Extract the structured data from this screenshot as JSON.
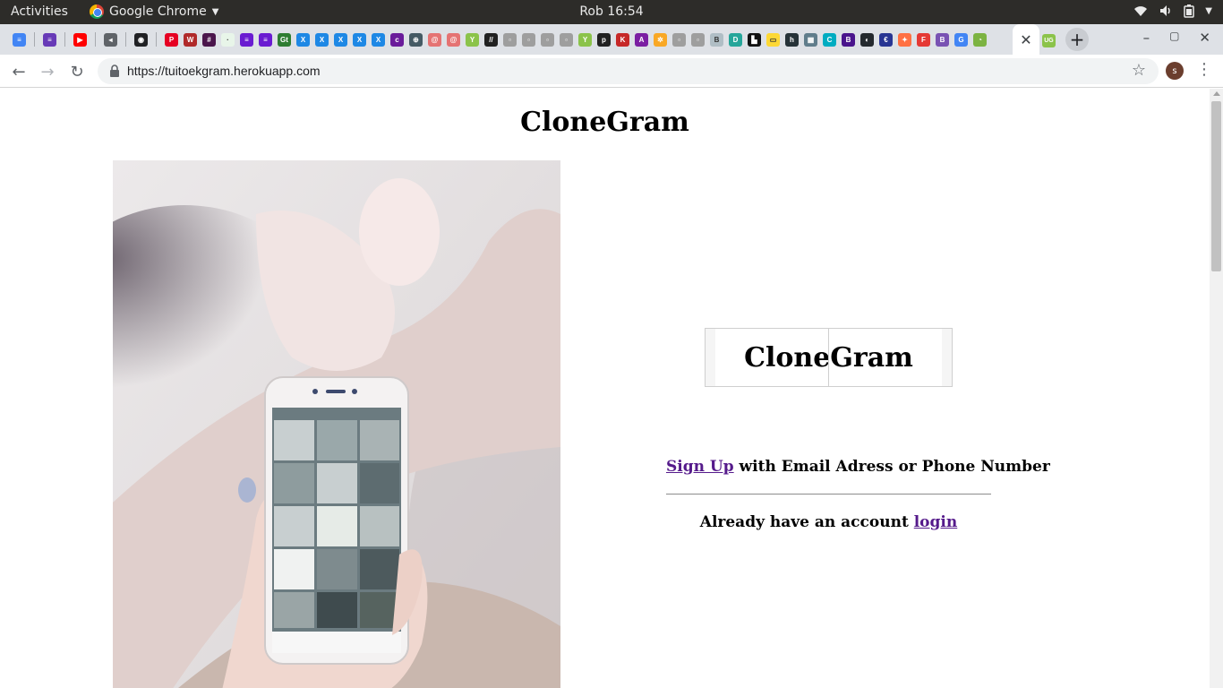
{
  "os_bar": {
    "activities": "Activities",
    "app_name": "Google Chrome",
    "clock": "Rob 16:54",
    "tray_icons": [
      "wifi-icon",
      "volume-icon",
      "battery-icon",
      "power-caret-icon"
    ]
  },
  "tabs": {
    "pinned_favicons": [
      {
        "name": "google-docs-favicon",
        "color": "#4285f4",
        "glyph": "≡"
      },
      {
        "name": "google-forms-favicon",
        "color": "#673ab7",
        "glyph": "≡"
      },
      {
        "name": "youtube-favicon",
        "color": "#ff0000",
        "glyph": "▶"
      },
      {
        "name": "audio-favicon",
        "color": "#5f6368",
        "glyph": "◂"
      },
      {
        "name": "record-favicon",
        "color": "#202124",
        "glyph": "◉"
      }
    ],
    "favicons": [
      {
        "name": "pinterest-favicon",
        "color": "#e60023",
        "glyph": "P"
      },
      {
        "name": "wordpress-favicon",
        "color": "#b02a2a",
        "glyph": "W"
      },
      {
        "name": "slack-favicon",
        "color": "#4a154b",
        "glyph": "#"
      },
      {
        "name": "bulb-favicon",
        "color": "#e8f5e9",
        "glyph": "·"
      },
      {
        "name": "list-favicon",
        "color": "#6a1bd1",
        "glyph": "≡"
      },
      {
        "name": "list-favicon",
        "color": "#6a1bd1",
        "glyph": "≡"
      },
      {
        "name": "gt-favicon",
        "color": "#2e7d32",
        "glyph": "Gt"
      },
      {
        "name": "x-favicon",
        "color": "#1e88e5",
        "glyph": "X"
      },
      {
        "name": "x-favicon",
        "color": "#1e88e5",
        "glyph": "X"
      },
      {
        "name": "x-favicon",
        "color": "#1e88e5",
        "glyph": "X"
      },
      {
        "name": "x-favicon",
        "color": "#1e88e5",
        "glyph": "X"
      },
      {
        "name": "x-favicon",
        "color": "#1e88e5",
        "glyph": "X"
      },
      {
        "name": "colorlib-favicon",
        "color": "#6a1b9a",
        "glyph": "c"
      },
      {
        "name": "globe-favicon",
        "color": "#455a64",
        "glyph": "⊕"
      },
      {
        "name": "swirl-favicon",
        "color": "#e57373",
        "glyph": "@"
      },
      {
        "name": "swirl-favicon",
        "color": "#e57373",
        "glyph": "@"
      },
      {
        "name": "tree-favicon",
        "color": "#8bc34a",
        "glyph": "Y"
      },
      {
        "name": "ink-favicon",
        "color": "#212121",
        "glyph": "//"
      },
      {
        "name": "page-favicon",
        "color": "#9e9e9e",
        "glyph": "▫"
      },
      {
        "name": "page-favicon",
        "color": "#9e9e9e",
        "glyph": "▫"
      },
      {
        "name": "page-favicon",
        "color": "#9e9e9e",
        "glyph": "▫"
      },
      {
        "name": "page-favicon",
        "color": "#9e9e9e",
        "glyph": "▫"
      },
      {
        "name": "tree-favicon",
        "color": "#8bc34a",
        "glyph": "Y"
      },
      {
        "name": "circle-favicon",
        "color": "#212121",
        "glyph": "p"
      },
      {
        "name": "kt-favicon",
        "color": "#c62828",
        "glyph": "K"
      },
      {
        "name": "ask-favicon",
        "color": "#7b1fa2",
        "glyph": "A"
      },
      {
        "name": "gear-favicon",
        "color": "#f9a825",
        "glyph": "✲"
      },
      {
        "name": "page-favicon",
        "color": "#9e9e9e",
        "glyph": "▫"
      },
      {
        "name": "page-favicon",
        "color": "#9e9e9e",
        "glyph": "▫"
      },
      {
        "name": "b-favicon",
        "color": "#b0bec5",
        "glyph": "B"
      },
      {
        "name": "d-favicon",
        "color": "#26a69a",
        "glyph": "D"
      },
      {
        "name": "black-favicon",
        "color": "#111111",
        "glyph": "▙"
      },
      {
        "name": "yellow-favicon",
        "color": "#fdd835",
        "glyph": "▭"
      },
      {
        "name": "h-favicon",
        "color": "#263238",
        "glyph": "h"
      },
      {
        "name": "grid-favicon",
        "color": "#607d8b",
        "glyph": "▦"
      },
      {
        "name": "c-favicon",
        "color": "#00acc1",
        "glyph": "C"
      },
      {
        "name": "b-favicon",
        "color": "#4a148c",
        "glyph": "B"
      },
      {
        "name": "github-favicon",
        "color": "#24292e",
        "glyph": "◐"
      },
      {
        "name": "e-favicon",
        "color": "#283593",
        "glyph": "€"
      },
      {
        "name": "pinwheel-favicon",
        "color": "#ff7043",
        "glyph": "✦"
      },
      {
        "name": "f-favicon",
        "color": "#e53935",
        "glyph": "F"
      },
      {
        "name": "bootstrap-favicon",
        "color": "#7952b3",
        "glyph": "B"
      },
      {
        "name": "google-favicon",
        "color": "#4285f4",
        "glyph": "G"
      },
      {
        "name": "leaf-favicon",
        "color": "#7cb342",
        "glyph": "◔"
      }
    ],
    "active_close": "✕",
    "extra_favicon": {
      "name": "ug-favicon",
      "color": "#8bc34a",
      "glyph": "UG"
    },
    "new_tab": "+",
    "window_controls": [
      "–",
      "▢",
      "✕"
    ]
  },
  "toolbar": {
    "back": "←",
    "forward": "→",
    "reload": "↻",
    "url": "https://tuitoekgram.herokuapp.com",
    "star": "☆",
    "avatar_letter": "s",
    "menu": "⋮"
  },
  "page": {
    "title": "CloneGram",
    "logo_text": "CloneGram",
    "signup_link": "Sign Up",
    "signup_text": " with Email Adress or Phone Number",
    "login_prefix": "Already have an account ",
    "login_link": "login"
  },
  "colors": {
    "link_visited": "#551a8b",
    "tabstrip_bg": "#dee1e6",
    "os_bar_bg": "#2d2c29"
  }
}
